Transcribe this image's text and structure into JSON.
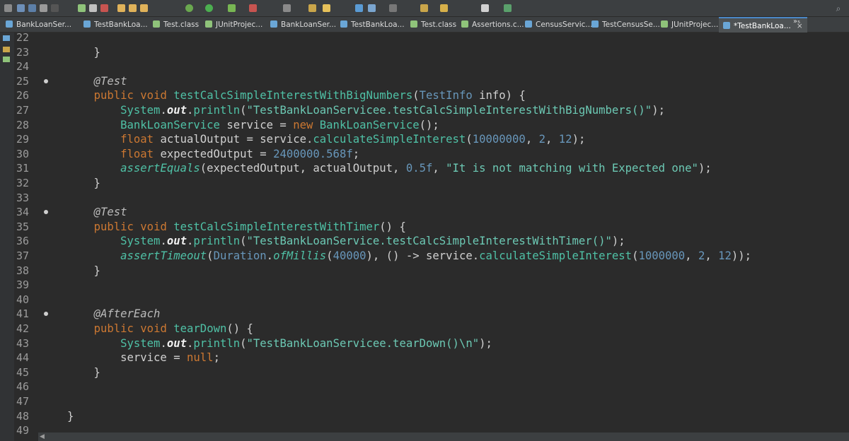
{
  "tabs": [
    {
      "label": "BankLoanSer...",
      "icon": "java-file-icon",
      "color": "#6aa6d6",
      "active": false
    },
    {
      "label": "TestBankLoa...",
      "icon": "java-file-icon",
      "color": "#6aa6d6",
      "active": false
    },
    {
      "label": "Test.class",
      "icon": "class-file-icon",
      "color": "#8fc37a",
      "active": false
    },
    {
      "label": "JUnitProjec...",
      "icon": "class-file-icon",
      "color": "#8fc37a",
      "active": false
    },
    {
      "label": "BankLoanSer...",
      "icon": "java-file-icon",
      "color": "#6aa6d6",
      "active": false
    },
    {
      "label": "TestBankLoa...",
      "icon": "java-file-icon",
      "color": "#6aa6d6",
      "active": false
    },
    {
      "label": "Test.class",
      "icon": "class-file-icon",
      "color": "#8fc37a",
      "active": false
    },
    {
      "label": "Assertions.c...",
      "icon": "class-file-icon",
      "color": "#8fc37a",
      "active": false
    },
    {
      "label": "CensusServic...",
      "icon": "java-file-icon",
      "color": "#6aa6d6",
      "active": false
    },
    {
      "label": "TestCensusSe...",
      "icon": "java-file-icon",
      "color": "#6aa6d6",
      "active": false
    },
    {
      "label": "JUnitProjec...",
      "icon": "class-file-icon",
      "color": "#8fc37a",
      "active": false
    },
    {
      "label": "*TestBankLoa...",
      "icon": "java-file-icon",
      "color": "#6aa6d6",
      "active": true
    }
  ],
  "tab_overflow": "»₅",
  "tab_close": "×",
  "lines": [
    {
      "n": "22",
      "fold": false,
      "tokens": []
    },
    {
      "n": "23",
      "fold": false,
      "tokens": [
        {
          "t": "    }",
          "c": "plain"
        }
      ]
    },
    {
      "n": "24",
      "fold": false,
      "tokens": []
    },
    {
      "n": "25",
      "fold": true,
      "tokens": [
        {
          "t": "    ",
          "c": "plain"
        },
        {
          "t": "@Test",
          "c": "ann"
        }
      ]
    },
    {
      "n": "26",
      "fold": false,
      "tokens": [
        {
          "t": "    ",
          "c": "plain"
        },
        {
          "t": "public",
          "c": "kw"
        },
        {
          "t": " ",
          "c": "plain"
        },
        {
          "t": "void",
          "c": "kw"
        },
        {
          "t": " ",
          "c": "plain"
        },
        {
          "t": "testCalcSimpleInterestWithBigNumbers",
          "c": "mth"
        },
        {
          "t": "(",
          "c": "plain"
        },
        {
          "t": "TestInfo",
          "c": "cls"
        },
        {
          "t": " info) {",
          "c": "plain"
        }
      ]
    },
    {
      "n": "27",
      "fold": false,
      "tokens": [
        {
          "t": "        ",
          "c": "plain"
        },
        {
          "t": "System",
          "c": "mth"
        },
        {
          "t": ".",
          "c": "plain"
        },
        {
          "t": "out",
          "c": "fld"
        },
        {
          "t": ".",
          "c": "plain"
        },
        {
          "t": "println",
          "c": "mth"
        },
        {
          "t": "(",
          "c": "plain"
        },
        {
          "t": "\"TestBankLoanServicee.testCalcSimpleInterestWithBigNumbers()\"",
          "c": "str"
        },
        {
          "t": ");",
          "c": "plain"
        }
      ]
    },
    {
      "n": "28",
      "fold": false,
      "tokens": [
        {
          "t": "        ",
          "c": "plain"
        },
        {
          "t": "BankLoanService",
          "c": "mth"
        },
        {
          "t": " service = ",
          "c": "plain"
        },
        {
          "t": "new",
          "c": "kw"
        },
        {
          "t": " ",
          "c": "plain"
        },
        {
          "t": "BankLoanService",
          "c": "mth"
        },
        {
          "t": "();",
          "c": "plain"
        }
      ]
    },
    {
      "n": "29",
      "fold": false,
      "tokens": [
        {
          "t": "        ",
          "c": "plain"
        },
        {
          "t": "float",
          "c": "kw"
        },
        {
          "t": " actualOutput = service.",
          "c": "plain"
        },
        {
          "t": "calculateSimpleInterest",
          "c": "mth"
        },
        {
          "t": "(",
          "c": "plain"
        },
        {
          "t": "10000000",
          "c": "num"
        },
        {
          "t": ", ",
          "c": "plain"
        },
        {
          "t": "2",
          "c": "num"
        },
        {
          "t": ", ",
          "c": "plain"
        },
        {
          "t": "12",
          "c": "num"
        },
        {
          "t": ");",
          "c": "plain"
        }
      ]
    },
    {
      "n": "30",
      "fold": false,
      "tokens": [
        {
          "t": "        ",
          "c": "plain"
        },
        {
          "t": "float",
          "c": "kw"
        },
        {
          "t": " expectedOutput = ",
          "c": "plain"
        },
        {
          "t": "2400000.568f",
          "c": "num"
        },
        {
          "t": ";",
          "c": "plain"
        }
      ]
    },
    {
      "n": "31",
      "fold": false,
      "tokens": [
        {
          "t": "        ",
          "c": "plain"
        },
        {
          "t": "assertEquals",
          "c": "stat"
        },
        {
          "t": "(expectedOutput, actualOutput, ",
          "c": "plain"
        },
        {
          "t": "0.5f",
          "c": "num"
        },
        {
          "t": ", ",
          "c": "plain"
        },
        {
          "t": "\"It is not matching with Expected one\"",
          "c": "str"
        },
        {
          "t": ");",
          "c": "plain"
        }
      ]
    },
    {
      "n": "32",
      "fold": false,
      "tokens": [
        {
          "t": "    }",
          "c": "plain"
        }
      ]
    },
    {
      "n": "33",
      "fold": false,
      "tokens": []
    },
    {
      "n": "34",
      "fold": true,
      "tokens": [
        {
          "t": "    ",
          "c": "plain"
        },
        {
          "t": "@Test",
          "c": "ann"
        }
      ]
    },
    {
      "n": "35",
      "fold": false,
      "tokens": [
        {
          "t": "    ",
          "c": "plain"
        },
        {
          "t": "public",
          "c": "kw"
        },
        {
          "t": " ",
          "c": "plain"
        },
        {
          "t": "void",
          "c": "kw"
        },
        {
          "t": " ",
          "c": "plain"
        },
        {
          "t": "testCalcSimpleInterestWithTimer",
          "c": "mth"
        },
        {
          "t": "() {",
          "c": "plain"
        }
      ]
    },
    {
      "n": "36",
      "fold": false,
      "tokens": [
        {
          "t": "        ",
          "c": "plain"
        },
        {
          "t": "System",
          "c": "mth"
        },
        {
          "t": ".",
          "c": "plain"
        },
        {
          "t": "out",
          "c": "fld"
        },
        {
          "t": ".",
          "c": "plain"
        },
        {
          "t": "println",
          "c": "mth"
        },
        {
          "t": "(",
          "c": "plain"
        },
        {
          "t": "\"TestBankLoanService.testCalcSimpleInterestWithTimer()\"",
          "c": "str"
        },
        {
          "t": ");",
          "c": "plain"
        }
      ]
    },
    {
      "n": "37",
      "fold": false,
      "tokens": [
        {
          "t": "        ",
          "c": "plain"
        },
        {
          "t": "assertTimeout",
          "c": "stat"
        },
        {
          "t": "(",
          "c": "plain"
        },
        {
          "t": "Duration",
          "c": "cls"
        },
        {
          "t": ".",
          "c": "plain"
        },
        {
          "t": "ofMillis",
          "c": "stat"
        },
        {
          "t": "(",
          "c": "plain"
        },
        {
          "t": "40000",
          "c": "num"
        },
        {
          "t": "), () -> service.",
          "c": "plain"
        },
        {
          "t": "calculateSimpleInterest",
          "c": "mth"
        },
        {
          "t": "(",
          "c": "plain"
        },
        {
          "t": "1000000",
          "c": "num"
        },
        {
          "t": ", ",
          "c": "plain"
        },
        {
          "t": "2",
          "c": "num"
        },
        {
          "t": ", ",
          "c": "plain"
        },
        {
          "t": "12",
          "c": "num"
        },
        {
          "t": "));",
          "c": "plain"
        }
      ]
    },
    {
      "n": "38",
      "fold": false,
      "tokens": [
        {
          "t": "    }",
          "c": "plain"
        }
      ]
    },
    {
      "n": "39",
      "fold": false,
      "tokens": []
    },
    {
      "n": "40",
      "fold": false,
      "tokens": []
    },
    {
      "n": "41",
      "fold": true,
      "tokens": [
        {
          "t": "    ",
          "c": "plain"
        },
        {
          "t": "@AfterEach",
          "c": "ann"
        }
      ]
    },
    {
      "n": "42",
      "fold": false,
      "tokens": [
        {
          "t": "    ",
          "c": "plain"
        },
        {
          "t": "public",
          "c": "kw"
        },
        {
          "t": " ",
          "c": "plain"
        },
        {
          "t": "void",
          "c": "kw"
        },
        {
          "t": " ",
          "c": "plain"
        },
        {
          "t": "tearDown",
          "c": "mth"
        },
        {
          "t": "() {",
          "c": "plain"
        }
      ]
    },
    {
      "n": "43",
      "fold": false,
      "tokens": [
        {
          "t": "        ",
          "c": "plain"
        },
        {
          "t": "System",
          "c": "mth"
        },
        {
          "t": ".",
          "c": "plain"
        },
        {
          "t": "out",
          "c": "fld"
        },
        {
          "t": ".",
          "c": "plain"
        },
        {
          "t": "println",
          "c": "mth"
        },
        {
          "t": "(",
          "c": "plain"
        },
        {
          "t": "\"TestBankLoanServicee.tearDown()\\n\"",
          "c": "str"
        },
        {
          "t": ");",
          "c": "plain"
        }
      ]
    },
    {
      "n": "44",
      "fold": false,
      "tokens": [
        {
          "t": "        service = ",
          "c": "plain"
        },
        {
          "t": "null",
          "c": "kw"
        },
        {
          "t": ";",
          "c": "plain"
        }
      ]
    },
    {
      "n": "45",
      "fold": false,
      "tokens": [
        {
          "t": "    }",
          "c": "plain"
        }
      ]
    },
    {
      "n": "46",
      "fold": false,
      "tokens": []
    },
    {
      "n": "47",
      "fold": false,
      "tokens": []
    },
    {
      "n": "48",
      "fold": false,
      "tokens": [
        {
          "t": "}",
          "c": "plain"
        }
      ]
    },
    {
      "n": "49",
      "fold": false,
      "tokens": []
    }
  ],
  "colors": {
    "background": "#2b2b2b",
    "keyword": "#cc7832",
    "method": "#4fc1a6",
    "number": "#6897bb",
    "string": "#6cc9b4",
    "active_tab_accent": "#4a88c7"
  }
}
